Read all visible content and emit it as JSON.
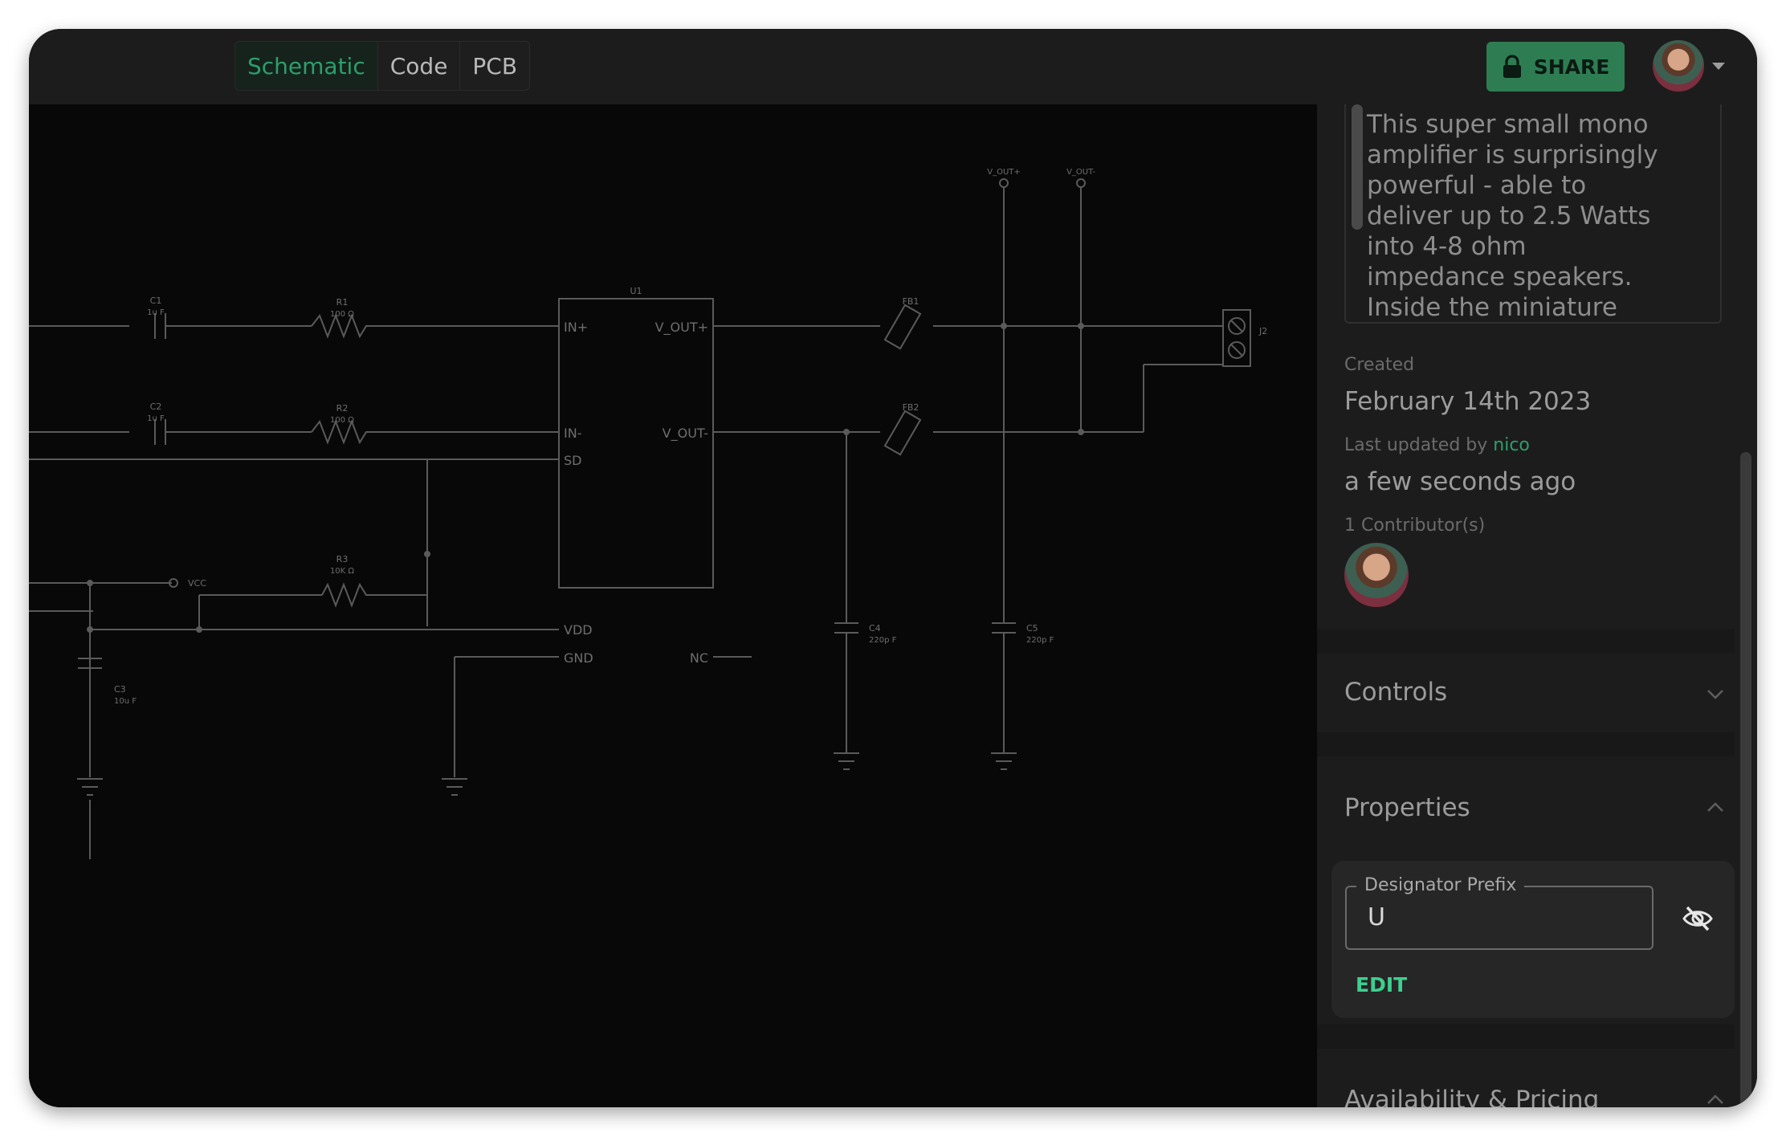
{
  "header": {
    "tabs": [
      {
        "label": "Schematic",
        "active": true
      },
      {
        "label": "Code",
        "active": false
      },
      {
        "label": "PCB",
        "active": false
      }
    ],
    "share_label": "SHARE",
    "share_icon": "lock-icon",
    "accent_color": "#2e9e6b"
  },
  "schematic": {
    "labels": {
      "c1": "C1",
      "c1_val": "1u F",
      "r1": "R1",
      "r1_val": "100 Ω",
      "c2": "C2",
      "c2_val": "1u F",
      "r2": "R2",
      "r2_val": "100 Ω",
      "r3": "R3",
      "r3_val": "10K Ω",
      "vcc": "VCC",
      "c3": "C3",
      "c3_val": "10u F",
      "u1": "U1",
      "pin_in_plus": "IN+",
      "pin_in_minus": "IN-",
      "pin_sd": "SD",
      "pin_vdd": "VDD",
      "pin_gnd": "GND",
      "pin_vout_plus": "V_OUT+",
      "pin_vout_minus": "V_OUT-",
      "pin_nc": "NC",
      "fb1": "FB1",
      "fb2": "FB2",
      "c4": "C4",
      "c4_val": "220p F",
      "c5": "C5",
      "c5_val": "220p F",
      "net_vout_plus": "V_OUT+",
      "net_vout_minus": "V_OUT-",
      "j2": "J2"
    }
  },
  "sidebar": {
    "description": "This super small mono amplifier is surprisingly powerful - able to deliver up to 2.5 Watts into 4-8 ohm impedance speakers. Inside the miniature chip",
    "created_label": "Created",
    "created_value": "February 14th 2023",
    "updated_prefix": "Last updated by ",
    "updated_user": "nico",
    "updated_value": "a few seconds ago",
    "contributors_label": "1 Contributor(s)",
    "controls_title": "Controls",
    "properties_title": "Properties",
    "field_label": "Designator Prefix",
    "field_value": "U",
    "edit_label": "EDIT",
    "pricing_title": "Availability & Pricing"
  }
}
